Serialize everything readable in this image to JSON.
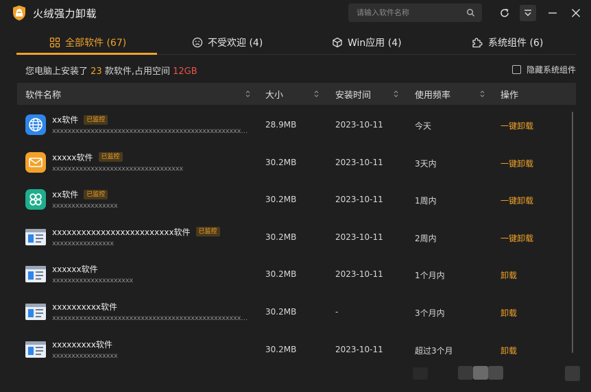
{
  "app": {
    "title": "火绒强力卸载",
    "search_placeholder": "请输入软件名称"
  },
  "colors": {
    "accent": "#f0a22a",
    "danger": "#e8534a",
    "background": "#1f1f1f"
  },
  "tabs": [
    {
      "label": "全部软件 (67)",
      "icon": "grid-icon",
      "active": true
    },
    {
      "label": "不受欢迎 (4)",
      "icon": "sad-face-icon",
      "active": false
    },
    {
      "label": "Win应用 (4)",
      "icon": "cube-icon",
      "active": false
    },
    {
      "label": "系统组件 (6)",
      "icon": "puzzle-icon",
      "active": false
    }
  ],
  "summary": {
    "prefix": "您电脑上安装了",
    "count": "23",
    "middle": "款软件,占用空间",
    "size": "12GB"
  },
  "hide_system": {
    "label": "隐藏系统组件",
    "checked": false
  },
  "table": {
    "headers": {
      "name": "软件名称",
      "size": "大小",
      "install_time": "安装时间",
      "frequency": "使用频率",
      "action": "操作"
    },
    "rows": [
      {
        "icon": "globe-icon",
        "name": "xx软件",
        "badge": "已监控",
        "path": "xxxxxxxxxxxxxxxxxxxxxxxxxxxxxxxxxxxxxxxxxxxxxxxxxxxxxxxxxxxxxxxxxxxxxxxxxxxxxxxxxxxxxxx",
        "size": "28.9MB",
        "date": "2023-10-11",
        "freq": "今天",
        "action": "一键卸载"
      },
      {
        "icon": "mail-icon",
        "name": "xxxxx软件",
        "badge": "已监控",
        "path": "xxxxxxxxxxxxxxxxxxxxxxxxxxxxxxxxxx",
        "size": "30.2MB",
        "date": "2023-10-11",
        "freq": "3天内",
        "action": "一键卸载"
      },
      {
        "icon": "clover-icon",
        "name": "xx软件",
        "badge": "已监控",
        "path": "xxxxxxxxxxxxxxxxx",
        "size": "30.2MB",
        "date": "2023-10-11",
        "freq": "1周内",
        "action": "一键卸载"
      },
      {
        "icon": "window-icon",
        "name": "xxxxxxxxxxxxxxxxxxxxxxxxx软件",
        "badge": "已监控",
        "path": "xxxxxxxxxxxxxxxx",
        "size": "30.2MB",
        "date": "2023-10-11",
        "freq": "2周内",
        "action": "一键卸载"
      },
      {
        "icon": "window-icon",
        "name": "xxxxxx软件",
        "badge": "",
        "path": "xxxxxxxxxxxxxxxxxxxxx",
        "size": "30.2MB",
        "date": "2023-10-11",
        "freq": "1个月内",
        "action": "卸载"
      },
      {
        "icon": "window-icon",
        "name": "xxxxxxxxxx软件",
        "badge": "",
        "path": "xxxxxxxxxxxxxxxxxxxxxxxxxxxxxxxxxxxxxxxxxxxxxxxxxxxxxxxxxxxxxxxxxxxxxxxxxxxxxxxxxxxxxxxx",
        "size": "30.2MB",
        "date": "-",
        "freq": "3个月内",
        "action": "卸载"
      },
      {
        "icon": "window-icon",
        "name": "xxxxxxxxx软件",
        "badge": "",
        "path": "xxxxxxxxxxxxxxxxx",
        "size": "30.2MB",
        "date": "2023-10-11",
        "freq": "超过3个月",
        "action": "卸载"
      }
    ]
  }
}
